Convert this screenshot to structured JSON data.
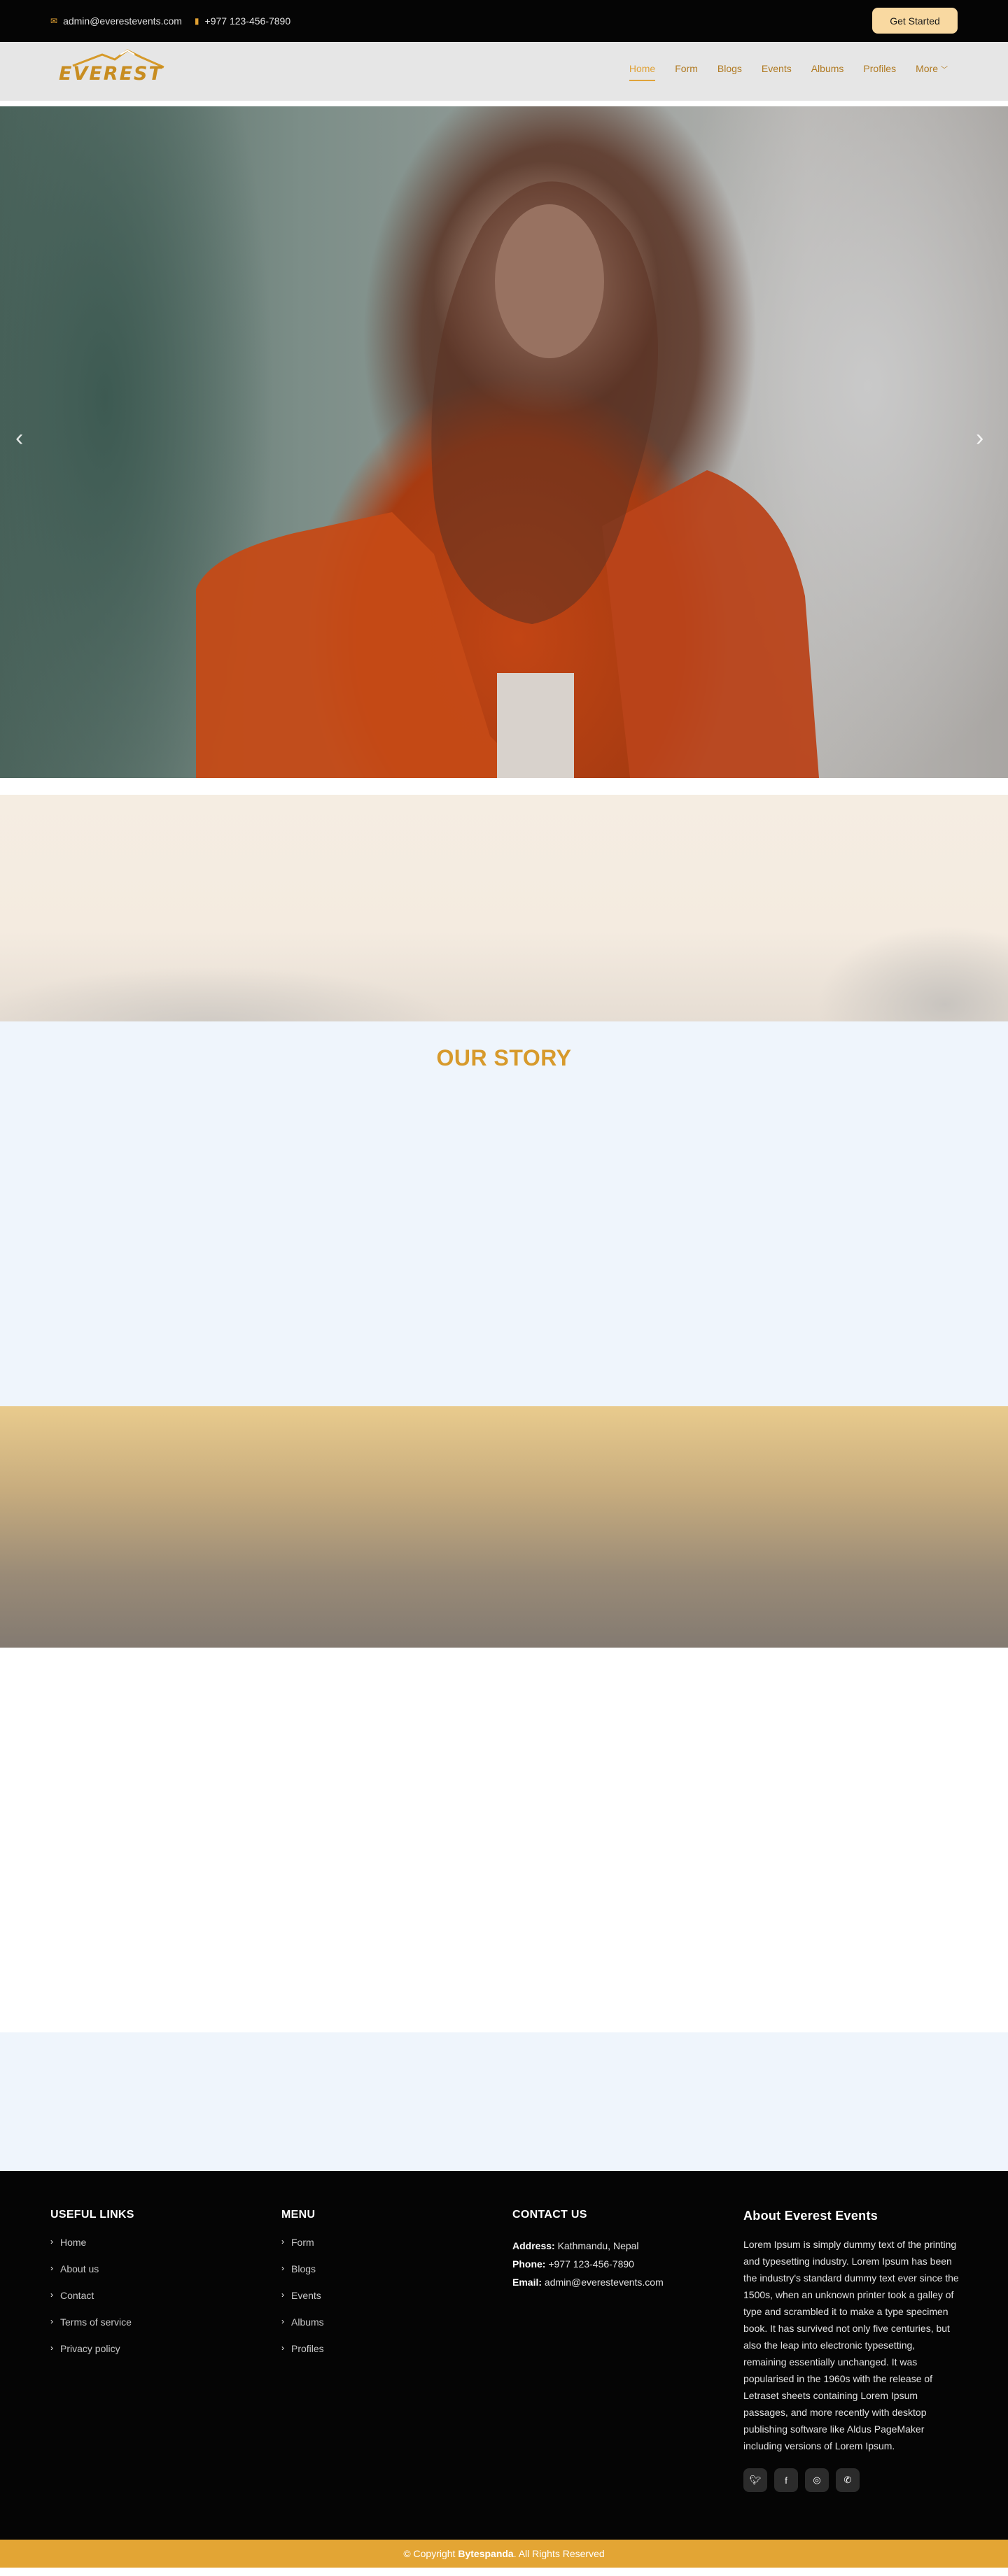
{
  "topbar": {
    "email": "admin@everestevents.com",
    "phone": "+977 123-456-7890",
    "cta": "Get Started",
    "email_icon": "envelope-icon",
    "phone_icon": "phone-icon"
  },
  "brand": {
    "logo_text": "EVEREST"
  },
  "nav": {
    "items": [
      "Home",
      "Form",
      "Blogs",
      "Events",
      "Albums",
      "Profiles"
    ],
    "more": "More",
    "active": "Home"
  },
  "hero": {
    "prev_icon": "chevron-left-icon",
    "next_icon": "chevron-right-icon"
  },
  "story": {
    "title": "OUR STORY"
  },
  "footer": {
    "useful_links": {
      "title": "USEFUL LINKS",
      "items": [
        "Home",
        "About us",
        "Contact",
        "Terms of service",
        "Privacy policy"
      ]
    },
    "menu": {
      "title": "MENU",
      "items": [
        "Form",
        "Blogs",
        "Events",
        "Albums",
        "Profiles"
      ]
    },
    "contact": {
      "title": "CONTACT US",
      "address_label": "Address:",
      "address": "Kathmandu, Nepal",
      "phone_label": "Phone:",
      "phone": "+977 123-456-7890",
      "email_label": "Email:",
      "email": "admin@everestevents.com"
    },
    "about": {
      "title": "About Everest Events",
      "text": "Lorem Ipsum is simply dummy text of the printing and typesetting industry. Lorem Ipsum has been the industry's standard dummy text ever since the 1500s, when an unknown printer took a galley of type and scrambled it to make a type specimen book. It has survived not only five centuries, but also the leap into electronic typesetting, remaining essentially unchanged. It was popularised in the 1960s with the release of Letraset sheets containing Lorem Ipsum passages, and more recently with desktop publishing software like Aldus PageMaker including versions of Lorem Ipsum.",
      "socials": [
        "twitter-icon",
        "facebook-icon",
        "instagram-icon",
        "whatsapp-icon"
      ]
    }
  },
  "copyright": {
    "prefix": "© Copyright",
    "company": "Bytespanda",
    "suffix": ". All Rights Reserved"
  },
  "colors": {
    "accent": "#e3a534",
    "nav_text": "#b07a22",
    "cta_bg": "#f9d9a1",
    "footer_bg": "#050505"
  }
}
